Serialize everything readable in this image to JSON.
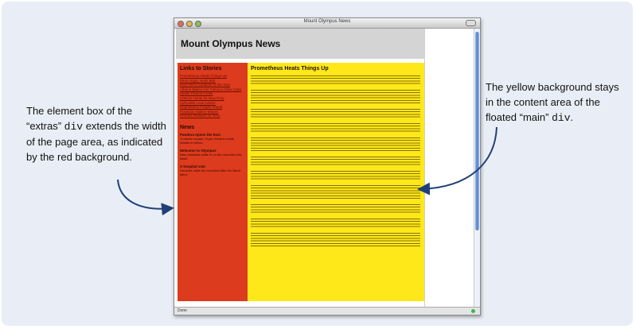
{
  "window": {
    "title": "Mount Olympus News",
    "status_text": "Done"
  },
  "page": {
    "site_title": "Mount Olympus News",
    "extras": {
      "heading": "Links to Stories",
      "links": [
        "Prometheus Heats Things Up",
        "Zeus Angry, Hurls Bolt",
        "Hera Wins Goddess of the Year",
        "Athena Bakes Her Famous Olive Cake",
        "Apollo Chariot Crash",
        "Artemis Hunts for New Prey",
        "Aphrodite Love Advice",
        "Hephaestus Forges Ahead",
        "Poseidon Makes Waves",
        "Hermes Delivers on Time"
      ],
      "news_heading": "News",
      "news_items": [
        {
          "title": "Pandora opens the box!",
          "text": "Troubles escape; Hope remains inside. Details to follow."
        },
        {
          "title": "Welcome to Olympus",
          "text": "New residents settle in on the mountain this week."
        },
        {
          "title": "A hospital visit",
          "text": "Heracles visits the wounded after his latest labor."
        }
      ]
    },
    "main": {
      "heading": "Prometheus Heats Things Up",
      "paragraph_count": 11
    }
  },
  "callouts": {
    "left": {
      "pre": "The element box of the “extras” ",
      "code": "div",
      "post": " extends the width of the page area, as indicated by the red background."
    },
    "right": {
      "pre": "The yellow background stays in the content area of the floated “main” ",
      "code": "div",
      "post": "."
    }
  },
  "colors": {
    "extras_bg": "#dd3b1d",
    "main_bg": "#ffe81a",
    "arrow": "#1f3f78",
    "panel_bg": "#e9eef6"
  },
  "icons": {
    "close": "close-icon",
    "minimize": "minimize-icon",
    "zoom": "zoom-icon"
  }
}
